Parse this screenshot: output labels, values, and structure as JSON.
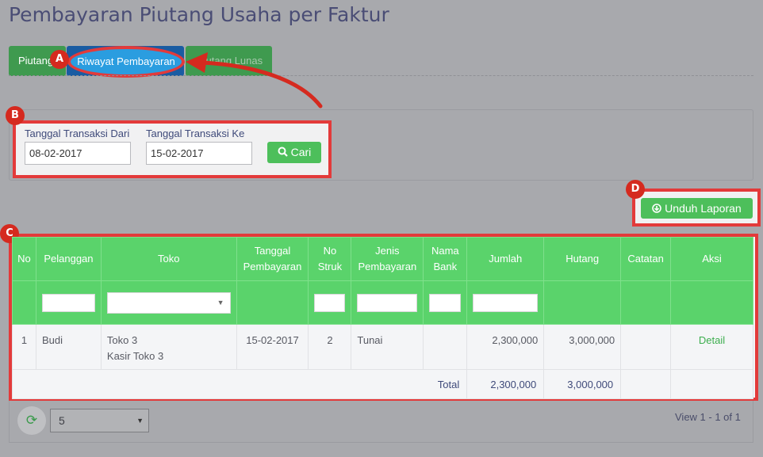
{
  "page": {
    "title": "Pembayaran Piutang Usaha per Faktur"
  },
  "tabs": [
    {
      "label": "Piutang"
    },
    {
      "label": "Riwayat Pembayaran"
    },
    {
      "label": "Piutang Lunas"
    }
  ],
  "badges": {
    "a": "A",
    "b": "B",
    "c": "C",
    "d": "D"
  },
  "filter": {
    "from_label": "Tanggal Transaksi Dari",
    "from_value": "08-02-2017",
    "to_label": "Tanggal Transaksi Ke",
    "to_value": "15-02-2017",
    "search_label": "Cari",
    "search_icon": "search-icon"
  },
  "download": {
    "label": "Unduh Laporan",
    "icon": "download-circle-icon"
  },
  "table": {
    "headers": {
      "no": "No",
      "pelanggan": "Pelanggan",
      "toko": "Toko",
      "tanggal_1": "Tanggal",
      "tanggal_2": "Pembayaran",
      "struk_1": "No",
      "struk_2": "Struk",
      "jenis_1": "Jenis",
      "jenis_2": "Pembayaran",
      "bank_1": "Nama",
      "bank_2": "Bank",
      "jumlah": "Jumlah",
      "hutang": "Hutang",
      "catatan": "Catatan",
      "aksi": "Aksi"
    },
    "rows": [
      {
        "no": "1",
        "pelanggan": "Budi",
        "toko_line1": "Toko 3",
        "toko_line2": "Kasir Toko 3",
        "tanggal": "15-02-2017",
        "struk": "2",
        "jenis": "Tunai",
        "bank": "",
        "jumlah": "2,300,000",
        "hutang": "3,000,000",
        "catatan": "",
        "aksi": "Detail"
      }
    ],
    "total": {
      "label": "Total",
      "jumlah": "2,300,000",
      "hutang": "3,000,000"
    }
  },
  "pager": {
    "page_size": "5",
    "view_info": "View 1 - 1 of 1",
    "refresh_icon": "refresh-icon"
  },
  "colors": {
    "header_green": "#5ad36b",
    "annotation_red": "#e33a3a",
    "active_tab_blue": "#2a9de0"
  }
}
